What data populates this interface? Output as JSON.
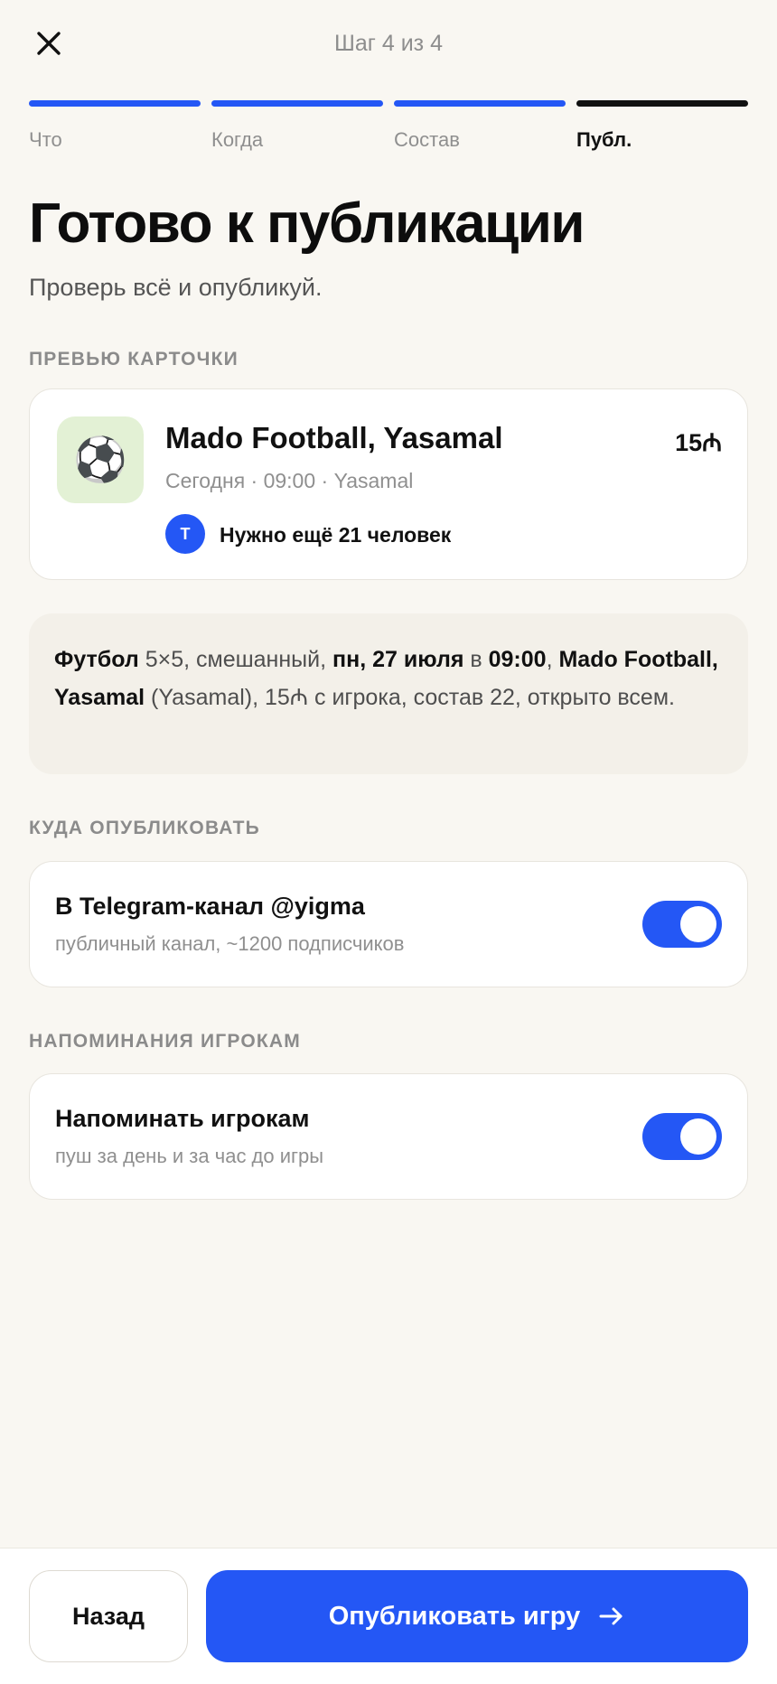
{
  "header": {
    "step_text": "Шаг 4 из 4"
  },
  "steps": [
    {
      "label": "Что",
      "state": "done"
    },
    {
      "label": "Когда",
      "state": "done"
    },
    {
      "label": "Состав",
      "state": "done"
    },
    {
      "label": "Публ.",
      "state": "current"
    }
  ],
  "title": "Готово к публикации",
  "subtitle": "Проверь всё и опубликуй.",
  "preview": {
    "section_label": "ПРЕВЬЮ КАРТОЧКИ",
    "icon": "soccer-ball",
    "emoji": "⚽",
    "name": "Mado Football, Yasamal",
    "price": "15₼",
    "meta": "Сегодня · 09:00 · Yasamal",
    "avatar_letter": "T",
    "need": "Нужно ещё 21 человек"
  },
  "summary": {
    "sport": "Футбол",
    "format": " 5×5, смешанный, ",
    "date": "пн, 27 июля",
    "at": " в ",
    "time": "09:00",
    "sep": ", ",
    "venue": "Mado Football, Yasamal",
    "rest": " (Yasamal), 15₼ с игрока, состав 22, открыто всем."
  },
  "publish_target": {
    "section_label": "КУДА ОПУБЛИКОВАТЬ",
    "title": "В Telegram-канал @yigma",
    "description": "публичный канал, ~1200 подписчиков",
    "enabled": true
  },
  "reminders": {
    "section_label": "НАПОМИНАНИЯ ИГРОКАМ",
    "title": "Напоминать игрокам",
    "description": "пуш за день и за час до игры",
    "enabled": true
  },
  "actions": {
    "back_label": "Назад",
    "publish_label": "Опубликовать игру"
  },
  "colors": {
    "accent": "#2457f5",
    "background": "#f9f7f2",
    "thumb_bg": "#e3f1d5"
  }
}
